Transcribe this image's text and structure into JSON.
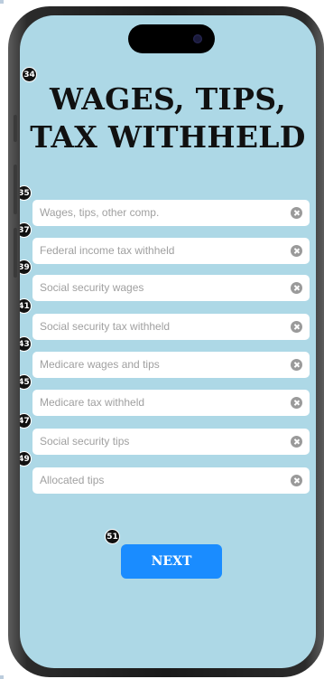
{
  "screen": {
    "title": "WAGES, TIPS, TAX WITHHELD",
    "background_color": "#add8e6"
  },
  "badges": {
    "title": "34",
    "next": "51"
  },
  "fields": [
    {
      "badge": "35",
      "placeholder": "Wages, tips, other comp."
    },
    {
      "badge": "37",
      "placeholder": "Federal income tax withheld"
    },
    {
      "badge": "39",
      "placeholder": "Social security wages"
    },
    {
      "badge": "41",
      "placeholder": "Social security tax withheld"
    },
    {
      "badge": "43",
      "placeholder": "Medicare wages and tips"
    },
    {
      "badge": "45",
      "placeholder": "Medicare tax withheld"
    },
    {
      "badge": "47",
      "placeholder": "Social security tips"
    },
    {
      "badge": "49",
      "placeholder": "Allocated tips"
    }
  ],
  "next_button": {
    "label": "NEXT",
    "color": "#1a8cff"
  }
}
